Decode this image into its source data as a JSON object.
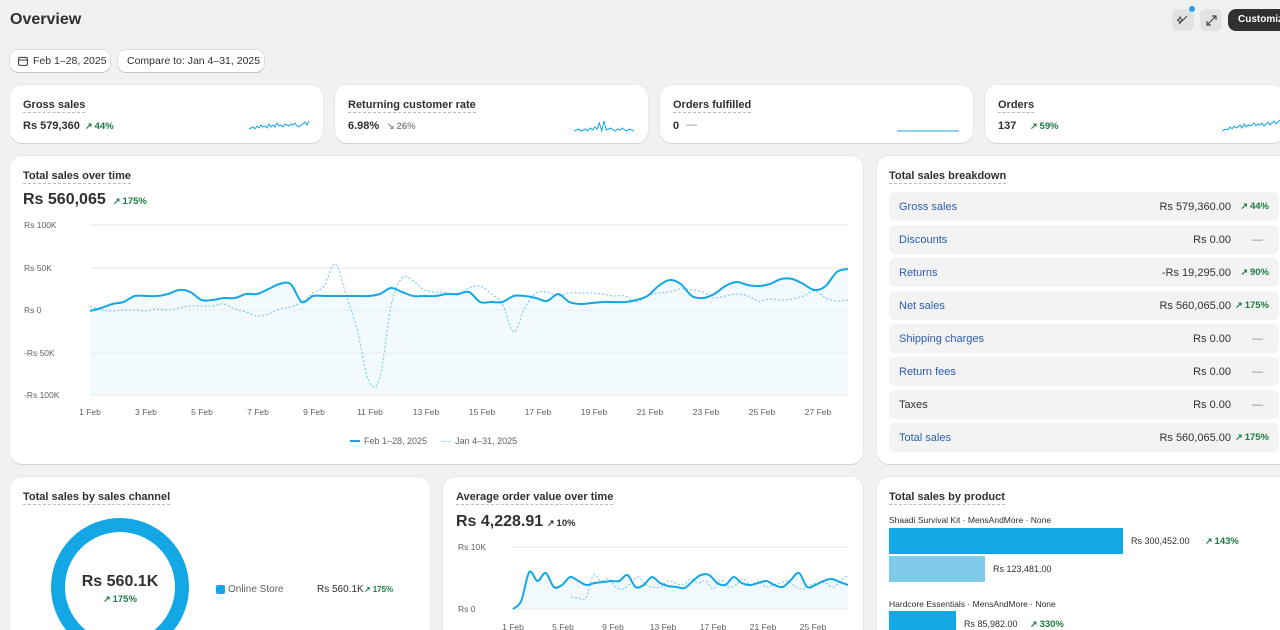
{
  "header": {
    "title": "Overview",
    "customize_label": "Customize"
  },
  "filters": {
    "date_range": "Feb 1–28, 2025",
    "compare": "Compare to: Jan 4–31, 2025"
  },
  "metrics": [
    {
      "label": "Gross sales",
      "value": "Rs 579,360",
      "change": "44%",
      "trend": "up"
    },
    {
      "label": "Returning customer rate",
      "value": "6.98%",
      "change": "26%",
      "trend": "down"
    },
    {
      "label": "Orders fulfilled",
      "value": "0",
      "change": "—",
      "trend": "flat"
    },
    {
      "label": "Orders",
      "value": "137",
      "change": "59%",
      "trend": "up"
    }
  ],
  "sales_over_time": {
    "title": "Total sales over time",
    "total": "Rs 560,065",
    "change": "175%",
    "legend_current": "Feb 1–28, 2025",
    "legend_previous": "Jan 4–31, 2025",
    "y_ticks": [
      "Rs 100K",
      "Rs 50K",
      "Rs 0",
      "-Rs 50K",
      "-Rs 100K"
    ],
    "x_ticks": [
      "1 Feb",
      "3 Feb",
      "5 Feb",
      "7 Feb",
      "9 Feb",
      "11 Feb",
      "13 Feb",
      "15 Feb",
      "17 Feb",
      "19 Feb",
      "21 Feb",
      "23 Feb",
      "25 Feb",
      "27 Feb"
    ]
  },
  "breakdown": {
    "title": "Total sales breakdown",
    "rows": [
      {
        "label": "Gross sales",
        "value": "Rs 579,360.00",
        "change": "44%",
        "up": true
      },
      {
        "label": "Discounts",
        "value": "Rs 0.00",
        "change": "—",
        "up": false
      },
      {
        "label": "Returns",
        "value": "-Rs 19,295.00",
        "change": "90%",
        "up": true
      },
      {
        "label": "Net sales",
        "value": "Rs 560,065.00",
        "change": "175%",
        "up": true
      },
      {
        "label": "Shipping charges",
        "value": "Rs 0.00",
        "change": "—",
        "up": false
      },
      {
        "label": "Return fees",
        "value": "Rs 0.00",
        "change": "—",
        "up": false
      },
      {
        "label": "Taxes",
        "value": "Rs 0.00",
        "change": "—",
        "up": false
      },
      {
        "label": "Total sales",
        "value": "Rs 560,065.00",
        "change": "175%",
        "up": true
      }
    ]
  },
  "by_channel": {
    "title": "Total sales by sales channel",
    "total": "Rs 560.1K",
    "change": "175%",
    "legend_label": "Online Store",
    "legend_value": "Rs 560.1K",
    "legend_change": "175%"
  },
  "aov": {
    "title": "Average order value over time",
    "value": "Rs 4,228.91",
    "change": "10%",
    "y_ticks": [
      "Rs 10K",
      "Rs 0"
    ],
    "x_ticks": [
      "1 Feb",
      "5 Feb",
      "9 Feb",
      "13 Feb",
      "17 Feb",
      "21 Feb",
      "25 Feb"
    ]
  },
  "by_product": {
    "title": "Total sales by product",
    "products": [
      {
        "name": "Shaadi Survival Kit · MensAndMore · None",
        "current": "Rs 300,452.00",
        "previous": "Rs 123,481.00",
        "change": "143%",
        "current_value": 300452,
        "previous_value": 123481
      },
      {
        "name": "Hardcore Essentials · MensAndMore · None",
        "current": "Rs 85,982.00",
        "change": "330%",
        "current_value": 85982
      }
    ]
  },
  "colors": {
    "accent": "#13a7e6",
    "compare": "#7fcbea",
    "positive": "#1a7a43",
    "link": "#2a5cb3"
  }
}
